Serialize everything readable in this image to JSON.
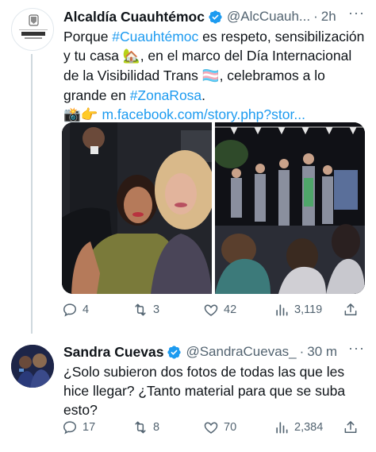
{
  "tweets": [
    {
      "author": "Alcaldía Cuauhtémoc",
      "handle": "@AlcCuauh...",
      "dot": "·",
      "time": "2h",
      "avatar_text": "ALCALDÍA CUAUHTÉMOC",
      "avatar_sub": "ES TU CASA",
      "text": {
        "p1": "Porque ",
        "tag1": "#Cuauhtémoc",
        "p2": " es respeto, sensibilización y tu casa ",
        "emoji_house": "🏡",
        "p3": ", en el marco del Día Internacional de la Visibilidad Trans ",
        "emoji_flag": "🏳️‍⚧️",
        "p4": ", celebramos a lo grande en ",
        "tag2": "#ZonaRosa",
        "p5": ".",
        "emoji_camera": "📸",
        "emoji_point": "👉",
        "link": "m.facebook.com/story.php?stor..."
      },
      "stats": {
        "replies": "4",
        "retweets": "3",
        "likes": "42",
        "views": "3,119"
      }
    },
    {
      "author": "Sandra Cuevas",
      "handle": "@SandraCuevas_",
      "dot": "·",
      "time": "30 m",
      "text": "¿Solo subieron dos fotos de todas las que les hice llegar? ¿Tanto material para que se suba esto?",
      "stats": {
        "replies": "17",
        "retweets": "8",
        "likes": "70",
        "views": "2,384"
      }
    }
  ],
  "colors": {
    "accent": "#1d9bf0",
    "muted": "#536471",
    "verified": "#1d9bf0"
  },
  "icons": [
    "verified-icon",
    "reply-icon",
    "retweet-icon",
    "like-icon",
    "views-icon",
    "share-icon",
    "more-icon"
  ]
}
